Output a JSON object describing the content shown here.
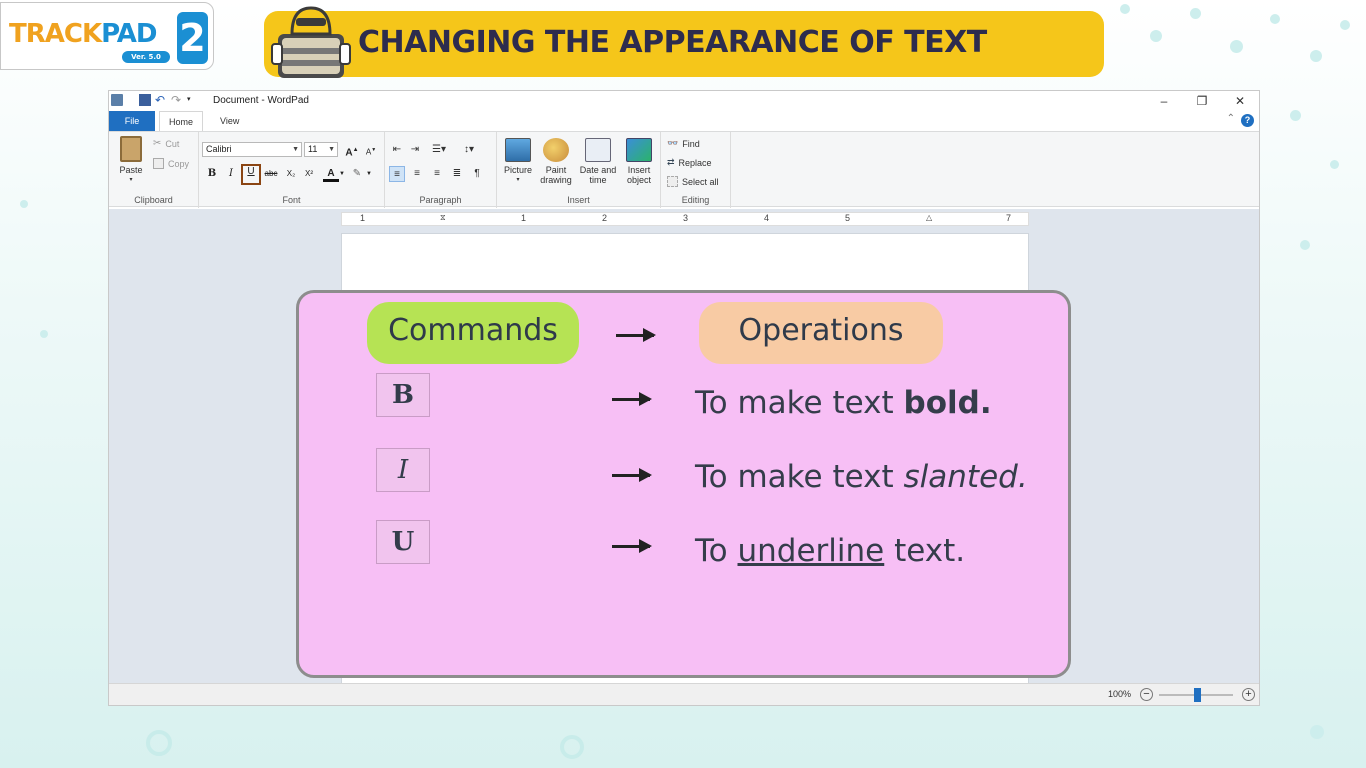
{
  "branding": {
    "logo_main": "TRACK",
    "logo_accent": "PAD",
    "logo_version": "Ver. 5.0",
    "logo_level": "2",
    "banner_title": "CHANGING THE APPEARANCE OF TEXT"
  },
  "window": {
    "title": "Document - WordPad",
    "controls": {
      "minimize": "–",
      "restore": "❐",
      "close": "✕"
    },
    "tabs": [
      "File",
      "Home",
      "View"
    ],
    "help": "?"
  },
  "ribbon": {
    "clipboard": {
      "paste": "Paste",
      "cut": "Cut",
      "copy": "Copy",
      "label": "Clipboard"
    },
    "font": {
      "family": "Calibri",
      "size": "11",
      "grow": "A",
      "shrink": "A",
      "bold": "B",
      "italic": "I",
      "underline": "U",
      "strike": "abc",
      "subscript": "X₂",
      "superscript": "X²",
      "color": "A",
      "highlight": "✎",
      "label": "Font"
    },
    "paragraph": {
      "label": "Paragraph"
    },
    "insert": {
      "picture": "Picture",
      "paint_line1": "Paint",
      "paint_line2": "drawing",
      "date_line1": "Date and",
      "date_line2": "time",
      "object_line1": "Insert",
      "object_line2": "object",
      "label": "Insert"
    },
    "editing": {
      "find": "Find",
      "replace": "Replace",
      "select_all": "Select all",
      "label": "Editing"
    }
  },
  "ruler": {
    "marks": [
      "1",
      "1",
      "2",
      "3",
      "4",
      "5",
      "7"
    ]
  },
  "status": {
    "zoom": "100%",
    "zoom_out": "−",
    "zoom_in": "+"
  },
  "panel": {
    "commands_header": "Commands",
    "operations_header": "Operations",
    "rows": [
      {
        "key": "B",
        "op_prefix": "To make text ",
        "op_styled": "bold",
        "op_suffix": "."
      },
      {
        "key": "I",
        "op_prefix": "To make text ",
        "op_styled": "slanted",
        "op_suffix": "."
      },
      {
        "key": "U",
        "op_prefix": "To ",
        "op_styled": "underline",
        "op_suffix": " text."
      }
    ]
  },
  "colors": {
    "banner": "#f5c61a",
    "panel_bg": "#f7bff5",
    "commands_pill": "#b6e354",
    "operations_pill": "#f8cba4",
    "file_tab": "#1f6fc1"
  }
}
